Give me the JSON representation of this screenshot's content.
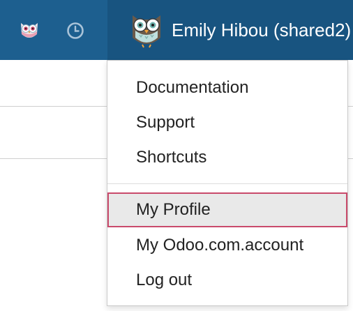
{
  "user": {
    "name": "Emily Hibou (shared2)"
  },
  "systray": {
    "owl_icon": "owl-icon",
    "clock_icon": "clock-icon"
  },
  "menu": {
    "items": [
      {
        "label": "Documentation"
      },
      {
        "label": "Support"
      },
      {
        "label": "Shortcuts"
      },
      {
        "label": "My Profile"
      },
      {
        "label": "My Odoo.com.account"
      },
      {
        "label": "Log out"
      }
    ],
    "highlighted": "My Profile"
  },
  "colors": {
    "navbar": "#1d5f8f",
    "navbar_active": "#185480",
    "highlight_border": "#c94a6b",
    "highlight_bg": "#e9e9e9"
  }
}
